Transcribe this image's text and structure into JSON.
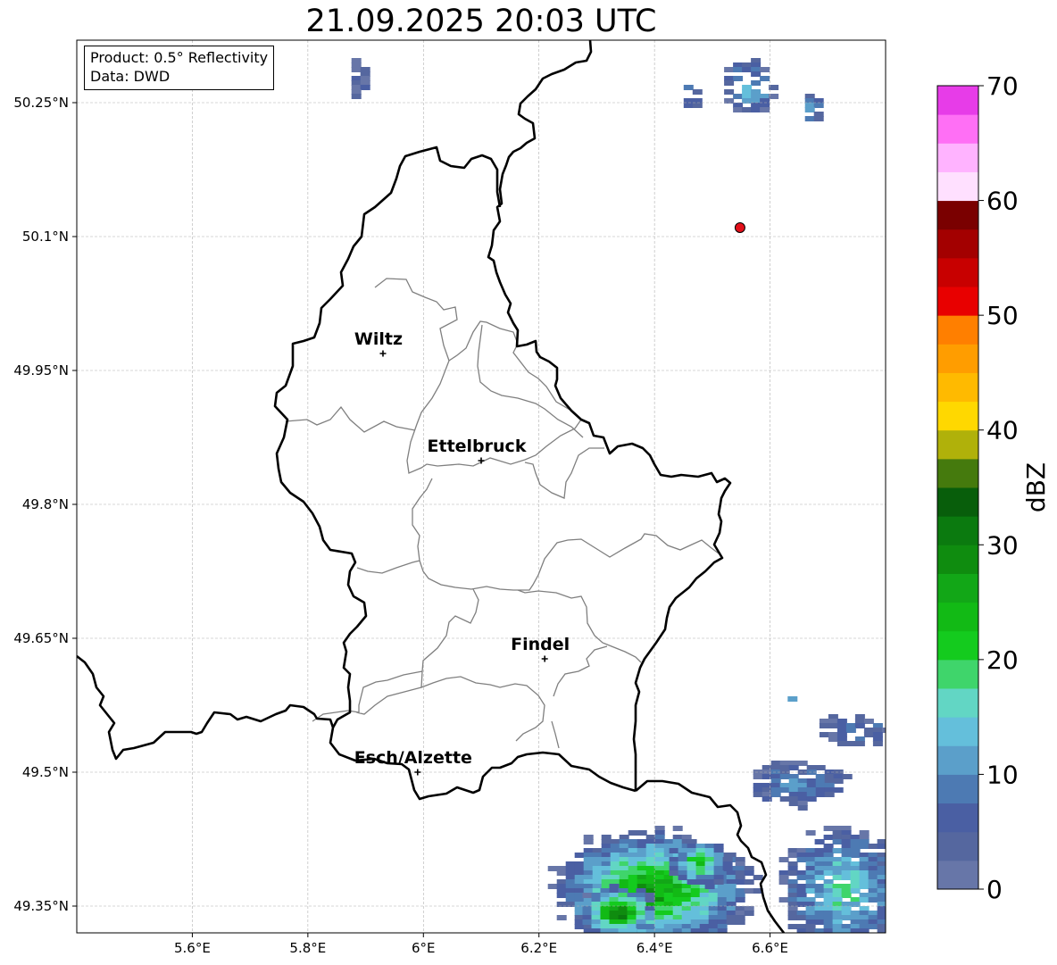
{
  "title": "21.09.2025 20:03 UTC",
  "info": {
    "product": "Product: 0.5° Reflectivity",
    "data_source": "Data: DWD"
  },
  "map": {
    "lon_range": [
      5.4,
      6.8
    ],
    "lat_range": [
      49.32,
      50.32
    ],
    "lon_ticks": [
      "5.6°E",
      "5.8°E",
      "6°E",
      "6.2°E",
      "6.4°E",
      "6.6°E"
    ],
    "lat_ticks": [
      "50.25°N",
      "50.1°N",
      "49.95°N",
      "49.8°N",
      "49.65°N",
      "49.5°N",
      "49.35°N"
    ],
    "grid": true,
    "cities": [
      {
        "name": "Wiltz",
        "lon": 5.93,
        "lat": 49.969
      },
      {
        "name": "Ettelbruck",
        "lon": 6.1,
        "lat": 49.849
      },
      {
        "name": "Findel",
        "lon": 6.21,
        "lat": 49.627
      },
      {
        "name": "Esch/Alzette",
        "lon": 5.99,
        "lat": 49.5
      }
    ],
    "radar_site": {
      "lon": 6.548,
      "lat": 50.11,
      "color": "#e3101a"
    }
  },
  "colorbar": {
    "label": "dBZ",
    "ticks": [
      "0",
      "10",
      "20",
      "30",
      "40",
      "50",
      "60",
      "70"
    ],
    "range": [
      0,
      70
    ],
    "colors": [
      "#6776a8",
      "#55679f",
      "#4a5fa3",
      "#4d7ab3",
      "#5b9fca",
      "#64bfdb",
      "#62d6c4",
      "#3fd56b",
      "#14cb1e",
      "#12ba15",
      "#12a717",
      "#0f8c0f",
      "#0b7a0f",
      "#085e0b",
      "#457a0d",
      "#b0b10a",
      "#ffd800",
      "#ffba00",
      "#ff9d00",
      "#ff7f00",
      "#e80000",
      "#c80000",
      "#a30000",
      "#7a0000",
      "#ffe0ff",
      "#ffb3ff",
      "#ff6ff5",
      "#e73ce8"
    ]
  }
}
